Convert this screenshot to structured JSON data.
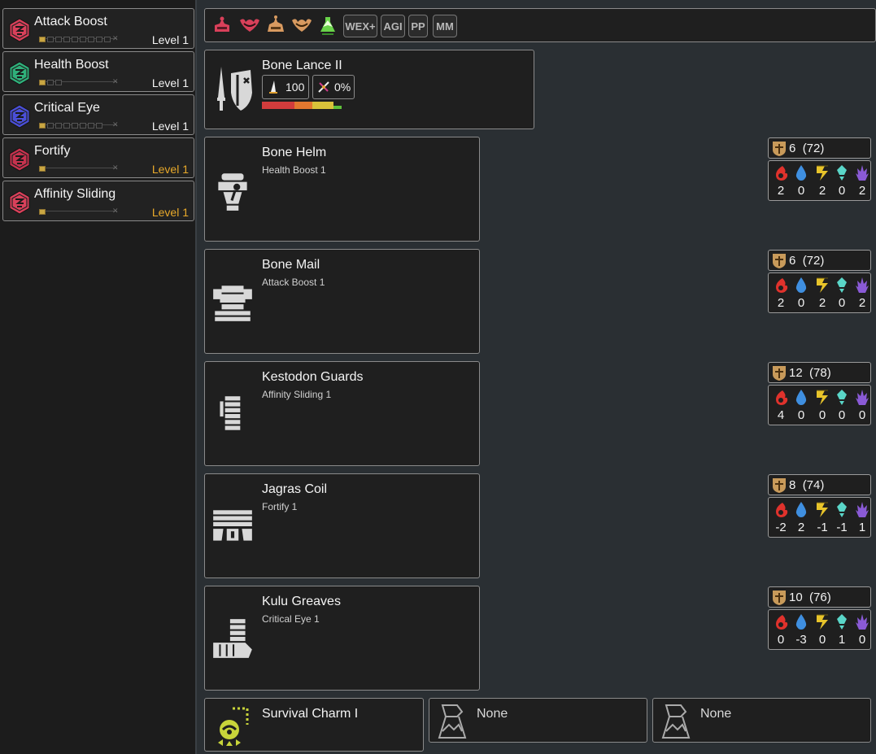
{
  "skills": [
    {
      "name": "Attack Boost",
      "level": "Level 1",
      "filled": 1,
      "total": 9,
      "color": "#d9405a",
      "gold": false
    },
    {
      "name": "Health Boost",
      "level": "Level 1",
      "filled": 1,
      "total": 3,
      "color": "#2fb07a",
      "gold": false
    },
    {
      "name": "Critical Eye",
      "level": "Level 1",
      "filled": 1,
      "total": 8,
      "color": "#4a4fd8",
      "gold": false
    },
    {
      "name": "Fortify",
      "level": "Level 1",
      "filled": 1,
      "total": 1,
      "color": "#c8324e",
      "gold": true
    },
    {
      "name": "Affinity Sliding",
      "level": "Level 1",
      "filled": 1,
      "total": 1,
      "color": "#d9405a",
      "gold": true
    }
  ],
  "topbar": {
    "icons": [
      "monster-icon-1",
      "monster-icon-2",
      "monster-icon-3",
      "monster-icon-4",
      "green-flask-icon"
    ],
    "tags": [
      "WEX+",
      "AGI",
      "PP",
      "MM"
    ]
  },
  "weapon": {
    "name": "Bone Lance II",
    "attack": "100",
    "affinity": "0%",
    "sharpness": [
      {
        "color": "#d23c3c",
        "value": 0.36
      },
      {
        "color": "#e2772f",
        "value": 0.2
      },
      {
        "color": "#d9c23a",
        "value": 0.24
      },
      {
        "color": "#5fc03a",
        "value": 0.09
      },
      {
        "color": "#1f1f1f",
        "value": 0.11
      }
    ]
  },
  "armor": [
    {
      "name": "Bone Helm",
      "skill": "Health Boost 1",
      "defense": "6",
      "max": "(72)",
      "res": [
        "2",
        "0",
        "2",
        "0",
        "2"
      ],
      "icon": "helm-icon"
    },
    {
      "name": "Bone Mail",
      "skill": "Attack Boost 1",
      "defense": "6",
      "max": "(72)",
      "res": [
        "2",
        "0",
        "2",
        "0",
        "2"
      ],
      "icon": "chest-icon"
    },
    {
      "name": "Kestodon Guards",
      "skill": "Affinity Sliding 1",
      "defense": "12",
      "max": "(78)",
      "res": [
        "4",
        "0",
        "0",
        "0",
        "0"
      ],
      "icon": "gauntlet-icon"
    },
    {
      "name": "Jagras Coil",
      "skill": "Fortify 1",
      "defense": "8",
      "max": "(74)",
      "res": [
        "-2",
        "2",
        "-1",
        "-1",
        "1"
      ],
      "icon": "waist-icon"
    },
    {
      "name": "Kulu Greaves",
      "skill": "Critical Eye 1",
      "defense": "10",
      "max": "(76)",
      "res": [
        "0",
        "-3",
        "0",
        "1",
        "0"
      ],
      "icon": "legs-icon"
    }
  ],
  "charm": {
    "name": "Survival Charm I"
  },
  "slots": [
    {
      "label": "None"
    },
    {
      "label": "None"
    }
  ],
  "colors": {
    "gold": "#e8a92a",
    "fire": "#e0322c",
    "water": "#3f8fe0",
    "thunder": "#e8c42a",
    "ice": "#5ad6c8",
    "dragon": "#8a5ad6"
  }
}
